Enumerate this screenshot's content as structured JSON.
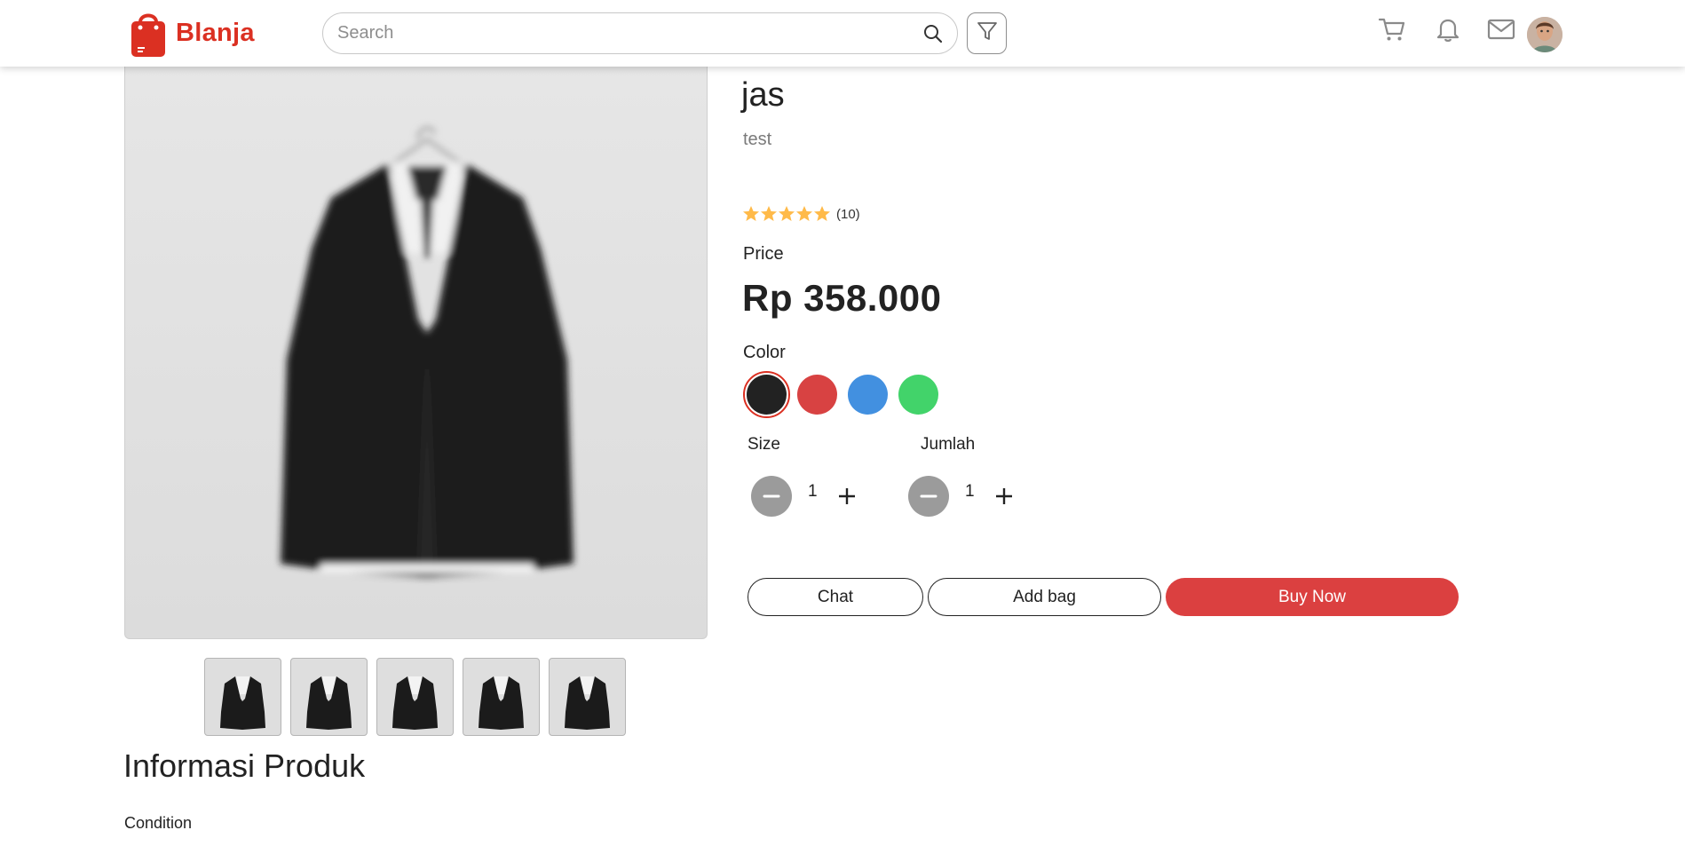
{
  "header": {
    "brand_name": "Blanja",
    "search_placeholder": "Search",
    "brand_color": "#DB3022",
    "icons": [
      "cart-icon",
      "bell-icon",
      "mail-icon",
      "avatar"
    ]
  },
  "product": {
    "name": "jas",
    "brand": "test",
    "rating_stars": 5,
    "rating_count": "(10)",
    "price_label": "Price",
    "price": "Rp 358.000",
    "color_label": "Color",
    "colors": [
      "#222222",
      "#D84242",
      "#4290E0",
      "#42D36A"
    ],
    "selected_color_index": 0,
    "size_label": "Size",
    "size_value": "1",
    "qty_label": "Jumlah",
    "qty_value": "1"
  },
  "actions": {
    "chat": "Chat",
    "add_bag": "Add bag",
    "buy_now": "Buy Now",
    "buy_color": "#DB4040"
  },
  "gallery": {
    "thumbnail_count": 5
  },
  "info": {
    "title": "Informasi Produk",
    "condition_label": "Condition"
  }
}
